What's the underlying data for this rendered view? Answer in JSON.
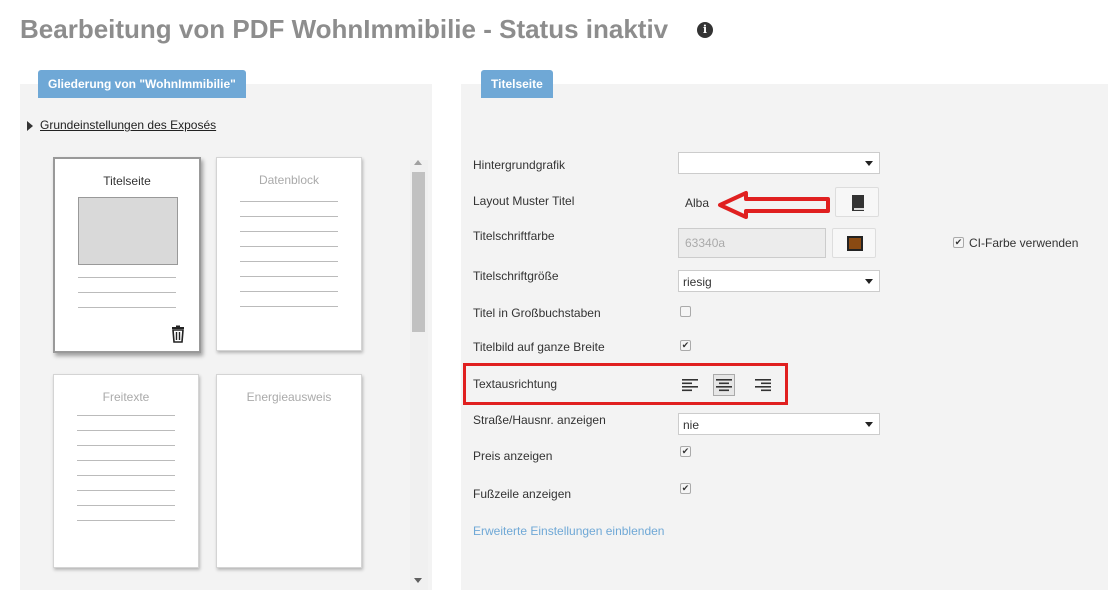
{
  "page": {
    "title": "Bearbeitung von PDF WohnImmibilie - Status inaktiv"
  },
  "left_panel": {
    "tab_label": "Gliederung von \"WohnImmibilie\"",
    "section_link": "Grundeinstellungen des Exposés",
    "cards": [
      {
        "label": "Titelseite",
        "active": true
      },
      {
        "label": "Datenblock",
        "active": false
      },
      {
        "label": "Freitexte",
        "active": false
      },
      {
        "label": "Energieausweis",
        "active": false
      }
    ]
  },
  "right_panel": {
    "tab_label": "Titelseite",
    "fields": {
      "hintergrundgrafik": {
        "label": "Hintergrundgrafik",
        "value": ""
      },
      "layout_muster": {
        "label": "Layout Muster Titel",
        "value": "Alba"
      },
      "titelschriftfarbe": {
        "label": "Titelschriftfarbe",
        "value": "63340a",
        "swatch": "#63340a"
      },
      "ci_farbe": {
        "label": "CI-Farbe verwenden",
        "checked": true
      },
      "titelschriftgroesse": {
        "label": "Titelschriftgröße",
        "value": "riesig"
      },
      "grossbuchstaben": {
        "label": "Titel in Großbuchstaben",
        "checked": false
      },
      "titelbild_breite": {
        "label": "Titelbild auf ganze Breite",
        "checked": true
      },
      "textausrichtung": {
        "label": "Textausrichtung",
        "options": [
          "left",
          "center",
          "right"
        ],
        "selected": "center"
      },
      "strasse": {
        "label": "Straße/Hausnr. anzeigen",
        "value": "nie"
      },
      "preis": {
        "label": "Preis anzeigen",
        "checked": true
      },
      "fusszeile": {
        "label": "Fußzeile anzeigen",
        "checked": true
      }
    },
    "advanced_link": "Erweiterte Einstellungen einblenden"
  },
  "colors": {
    "accent": "#6fa8d6",
    "annotation_red": "#e02020",
    "title_gray": "#8d8d8d"
  },
  "icons": [
    "info-icon",
    "book-icon",
    "color-picker-icon",
    "trash-icon",
    "align-left-icon",
    "align-center-icon",
    "align-right-icon"
  ]
}
